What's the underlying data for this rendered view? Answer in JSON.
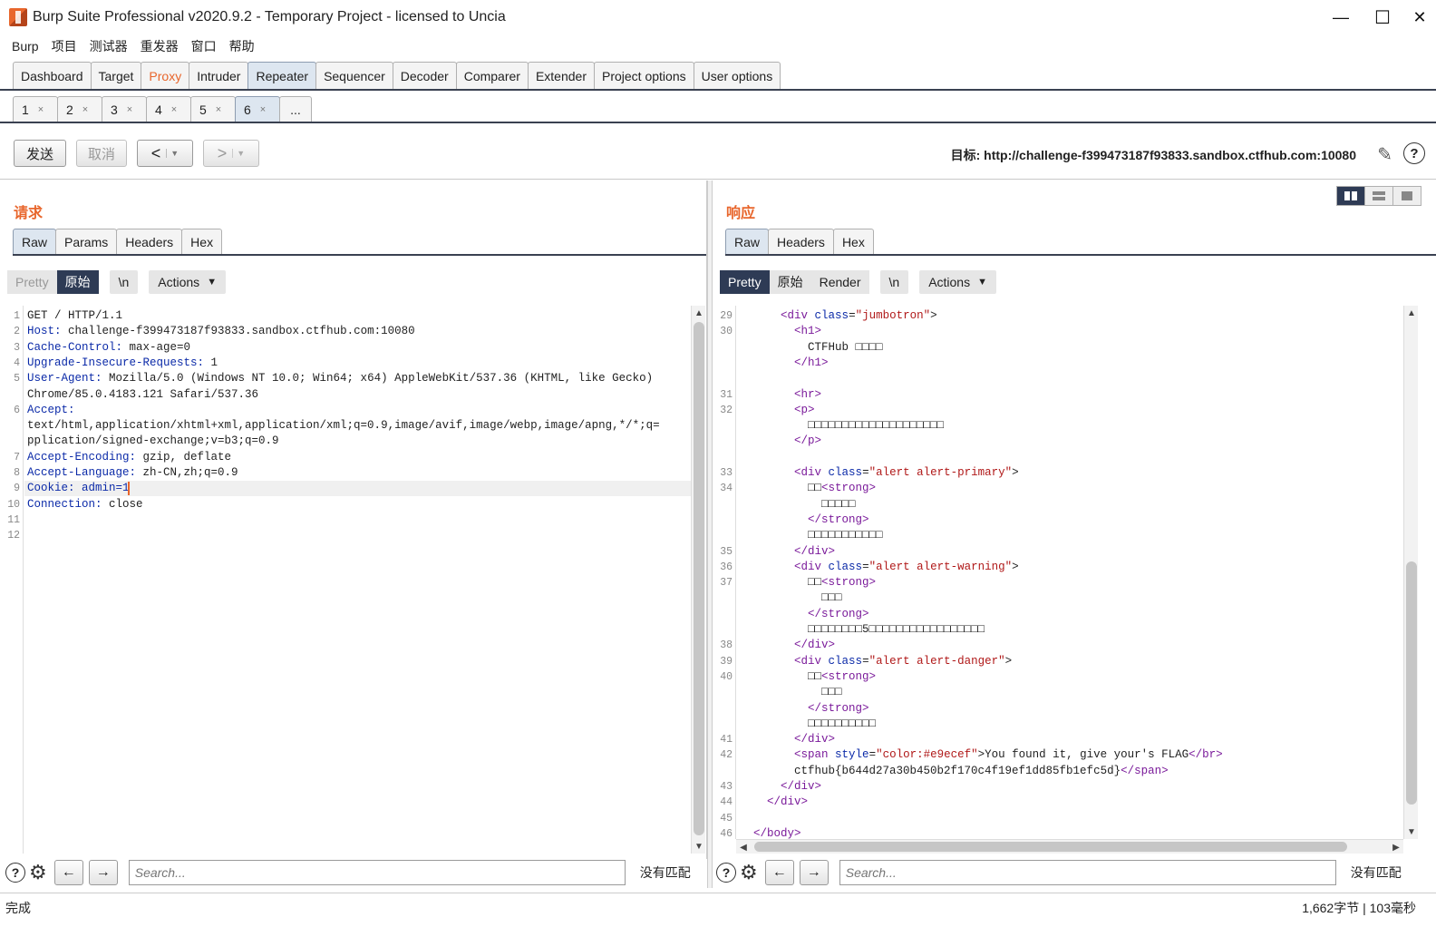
{
  "window": {
    "title": "Burp Suite Professional v2020.9.2 - Temporary Project - licensed to Uncia",
    "minimize": "—",
    "maximize": "☐",
    "close": "✕"
  },
  "menu": [
    "Burp",
    "项目",
    "测试器",
    "重发器",
    "窗口",
    "帮助"
  ],
  "main_tabs": [
    {
      "label": "Dashboard",
      "active": false
    },
    {
      "label": "Target",
      "active": false
    },
    {
      "label": "Proxy",
      "active": false,
      "highlight": "#e8662c"
    },
    {
      "label": "Intruder",
      "active": false
    },
    {
      "label": "Repeater",
      "active": true
    },
    {
      "label": "Sequencer",
      "active": false
    },
    {
      "label": "Decoder",
      "active": false
    },
    {
      "label": "Comparer",
      "active": false
    },
    {
      "label": "Extender",
      "active": false
    },
    {
      "label": "Project options",
      "active": false
    },
    {
      "label": "User options",
      "active": false
    }
  ],
  "repeater_tabs": {
    "items": [
      "1",
      "2",
      "3",
      "4",
      "5",
      "6"
    ],
    "active_index": 5,
    "close_glyph": "×",
    "more": "..."
  },
  "toolbar": {
    "send": "发送",
    "cancel": "取消",
    "back": "<",
    "forward": ">",
    "target": "目标: http://challenge-f399473187f93833.sandbox.ctfhub.com:10080",
    "help": "?"
  },
  "request": {
    "title": "请求",
    "tabs": [
      "Raw",
      "Params",
      "Headers",
      "Hex"
    ],
    "view_pretty": "Pretty",
    "view_raw": "原始",
    "newline": "\\n",
    "actions": "Actions",
    "lines": [
      {
        "n": "1",
        "key": "",
        "text": "GET / HTTP/1.1"
      },
      {
        "n": "2",
        "key": "Host:",
        "text": " challenge-f399473187f93833.sandbox.ctfhub.com:10080"
      },
      {
        "n": "3",
        "key": "Cache-Control:",
        "text": " max-age=0"
      },
      {
        "n": "4",
        "key": "Upgrade-Insecure-Requests:",
        "text": " 1"
      },
      {
        "n": "5",
        "key": "User-Agent:",
        "text": " Mozilla/5.0 (Windows NT 10.0; Win64; x64) AppleWebKit/537.36 (KHTML, like Gecko)"
      },
      {
        "n": "",
        "key": "",
        "text": "Chrome/85.0.4183.121 Safari/537.36"
      },
      {
        "n": "6",
        "key": "Accept:",
        "text": ""
      },
      {
        "n": "",
        "key": "",
        "text": "text/html,application/xhtml+xml,application/xml;q=0.9,image/avif,image/webp,image/apng,*/*;q="
      },
      {
        "n": "",
        "key": "",
        "text": "pplication/signed-exchange;v=b3;q=0.9"
      },
      {
        "n": "7",
        "key": "Accept-Encoding:",
        "text": " gzip, deflate"
      },
      {
        "n": "8",
        "key": "Accept-Language:",
        "text": " zh-CN,zh;q=0.9"
      },
      {
        "n": "9",
        "key": "Cookie:",
        "text": " admin=1",
        "cookie": true
      },
      {
        "n": "10",
        "key": "Connection:",
        "text": " close"
      },
      {
        "n": "11",
        "key": "",
        "text": ""
      },
      {
        "n": "12",
        "key": "",
        "text": ""
      }
    ]
  },
  "response": {
    "title": "响应",
    "tabs": [
      "Raw",
      "Headers",
      "Hex"
    ],
    "view_pretty": "Pretty",
    "view_raw": "原始",
    "view_render": "Render",
    "newline": "\\n",
    "actions": "Actions",
    "lines": [
      {
        "n": "29",
        "html": "      <span class=\"tag\">&lt;div</span> <span class=\"attr\">class</span>=<span class=\"val\">\"jumbotron\"</span><span class=\"tag\"></span>&gt;"
      },
      {
        "n": "30",
        "html": "        <span class=\"tag\">&lt;h1&gt;</span>"
      },
      {
        "n": "",
        "html": "          CTFHub □□□□"
      },
      {
        "n": "",
        "html": "        <span class=\"tag\">&lt;/h1&gt;</span>"
      },
      {
        "n": "",
        "html": ""
      },
      {
        "n": "31",
        "html": "        <span class=\"tag\">&lt;hr&gt;</span>"
      },
      {
        "n": "32",
        "html": "        <span class=\"tag\">&lt;p&gt;</span>"
      },
      {
        "n": "",
        "html": "          □□□□□□□□□□□□□□□□□□□□"
      },
      {
        "n": "",
        "html": "        <span class=\"tag\">&lt;/p&gt;</span>"
      },
      {
        "n": "",
        "html": ""
      },
      {
        "n": "33",
        "html": "        <span class=\"tag\">&lt;div</span> <span class=\"attr\">class</span>=<span class=\"val\">\"alert alert-primary\"</span>&gt;"
      },
      {
        "n": "34",
        "html": "          □□<span class=\"tag\">&lt;strong&gt;</span>"
      },
      {
        "n": "",
        "html": "            □□□□□"
      },
      {
        "n": "",
        "html": "          <span class=\"tag\">&lt;/strong&gt;</span>"
      },
      {
        "n": "",
        "html": "          □□□□□□□□□□□"
      },
      {
        "n": "35",
        "html": "        <span class=\"tag\">&lt;/div&gt;</span>"
      },
      {
        "n": "36",
        "html": "        <span class=\"tag\">&lt;div</span> <span class=\"attr\">class</span>=<span class=\"val\">\"alert alert-warning\"</span>&gt;"
      },
      {
        "n": "37",
        "html": "          □□<span class=\"tag\">&lt;strong&gt;</span>"
      },
      {
        "n": "",
        "html": "            □□□"
      },
      {
        "n": "",
        "html": "          <span class=\"tag\">&lt;/strong&gt;</span>"
      },
      {
        "n": "",
        "html": "          □□□□□□□□5□□□□□□□□□□□□□□□□□"
      },
      {
        "n": "38",
        "html": "        <span class=\"tag\">&lt;/div&gt;</span>"
      },
      {
        "n": "39",
        "html": "        <span class=\"tag\">&lt;div</span> <span class=\"attr\">class</span>=<span class=\"val\">\"alert alert-danger\"</span>&gt;"
      },
      {
        "n": "40",
        "html": "          □□<span class=\"tag\">&lt;strong&gt;</span>"
      },
      {
        "n": "",
        "html": "            □□□"
      },
      {
        "n": "",
        "html": "          <span class=\"tag\">&lt;/strong&gt;</span>"
      },
      {
        "n": "",
        "html": "          □□□□□□□□□□"
      },
      {
        "n": "41",
        "html": "        <span class=\"tag\">&lt;/div&gt;</span>"
      },
      {
        "n": "42",
        "html": "        <span class=\"tag\">&lt;span</span> <span class=\"attr\">style</span>=<span class=\"val\">\"color:#e9ecef\"</span>&gt;You found it, give your's FLAG<span class=\"tag\">&lt;/br&gt;</span>"
      },
      {
        "n": "",
        "html": "        ctfhub{b644d27a30b450b2f170c4f19ef1dd85fb1efc5d}<span class=\"tag\">&lt;/span&gt;</span>"
      },
      {
        "n": "43",
        "html": "      <span class=\"tag\">&lt;/div&gt;</span>"
      },
      {
        "n": "44",
        "html": "    <span class=\"tag\">&lt;/div&gt;</span>"
      },
      {
        "n": "45",
        "html": ""
      },
      {
        "n": "46",
        "html": "  <span class=\"tag\">&lt;/body&gt;</span>"
      }
    ]
  },
  "search": {
    "placeholder": "Search...",
    "no_match": "没有匹配"
  },
  "status": {
    "left": "完成",
    "right": "1,662字节 | 103毫秒"
  },
  "colors": {
    "accent": "#e8662c",
    "active_dark": "#2e3b55",
    "header_key": "#0b2aa8",
    "tag": "#7a1a9a",
    "value": "#b01818"
  }
}
